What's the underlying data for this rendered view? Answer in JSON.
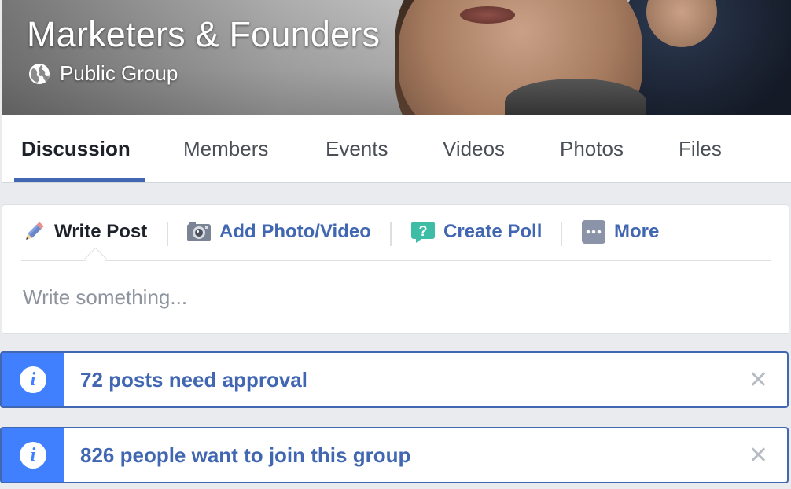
{
  "group": {
    "title": "Marketers & Founders",
    "privacy_label": "Public Group",
    "privacy_icon": "globe-icon"
  },
  "tabs": [
    {
      "label": "Discussion",
      "active": true
    },
    {
      "label": "Members",
      "active": false
    },
    {
      "label": "Events",
      "active": false
    },
    {
      "label": "Videos",
      "active": false
    },
    {
      "label": "Photos",
      "active": false
    },
    {
      "label": "Files",
      "active": false
    }
  ],
  "composer": {
    "actions": [
      {
        "label": "Write Post",
        "icon": "pencil-icon"
      },
      {
        "label": "Add Photo/Video",
        "icon": "camera-icon"
      },
      {
        "label": "Create Poll",
        "icon": "poll-question-icon"
      },
      {
        "label": "More",
        "icon": "more-dots-icon"
      }
    ],
    "placeholder": "Write something..."
  },
  "notices": [
    {
      "text": "72 posts need approval",
      "icon": "info-icon",
      "close": "✕"
    },
    {
      "text": "826 people want to join this group",
      "icon": "info-icon",
      "close": "✕"
    }
  ],
  "colors": {
    "accent": "#4267b2",
    "info_block": "#4080ff",
    "background": "#e9ebee"
  }
}
